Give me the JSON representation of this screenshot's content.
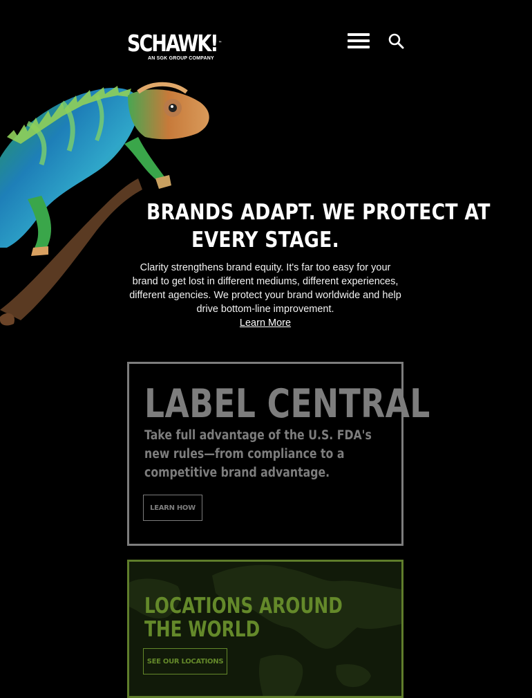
{
  "header": {
    "logo_text": "SCHAWK!",
    "logo_tm": "™",
    "logo_tagline": "AN SGK GROUP COMPANY",
    "menu_icon": "hamburger-menu-icon",
    "search_icon": "search-icon"
  },
  "hero": {
    "title_line1": "BRANDS ADAPT. WE PROTECT AT",
    "title_line2": "EVERY STAGE.",
    "body": "Clarity strengthens brand equity. It's far too easy for your brand to get lost in different mediums, different experiences, different agencies. We protect your brand worldwide and help drive bottom-line improvement.",
    "link_label": "Learn More"
  },
  "label_central": {
    "title": "LABEL CENTRAL",
    "description": "Take full advantage of the U.S. FDA's new rules—from compliance to a competitive brand advantage.",
    "button_label": "LEARN HOW",
    "color": "#7d7d7d"
  },
  "locations": {
    "title": "LOCATIONS AROUND THE WORLD",
    "button_label": "SEE OUR LOCATIONS",
    "color": "#64892a"
  },
  "colors": {
    "background": "#000000",
    "text": "#ffffff"
  }
}
